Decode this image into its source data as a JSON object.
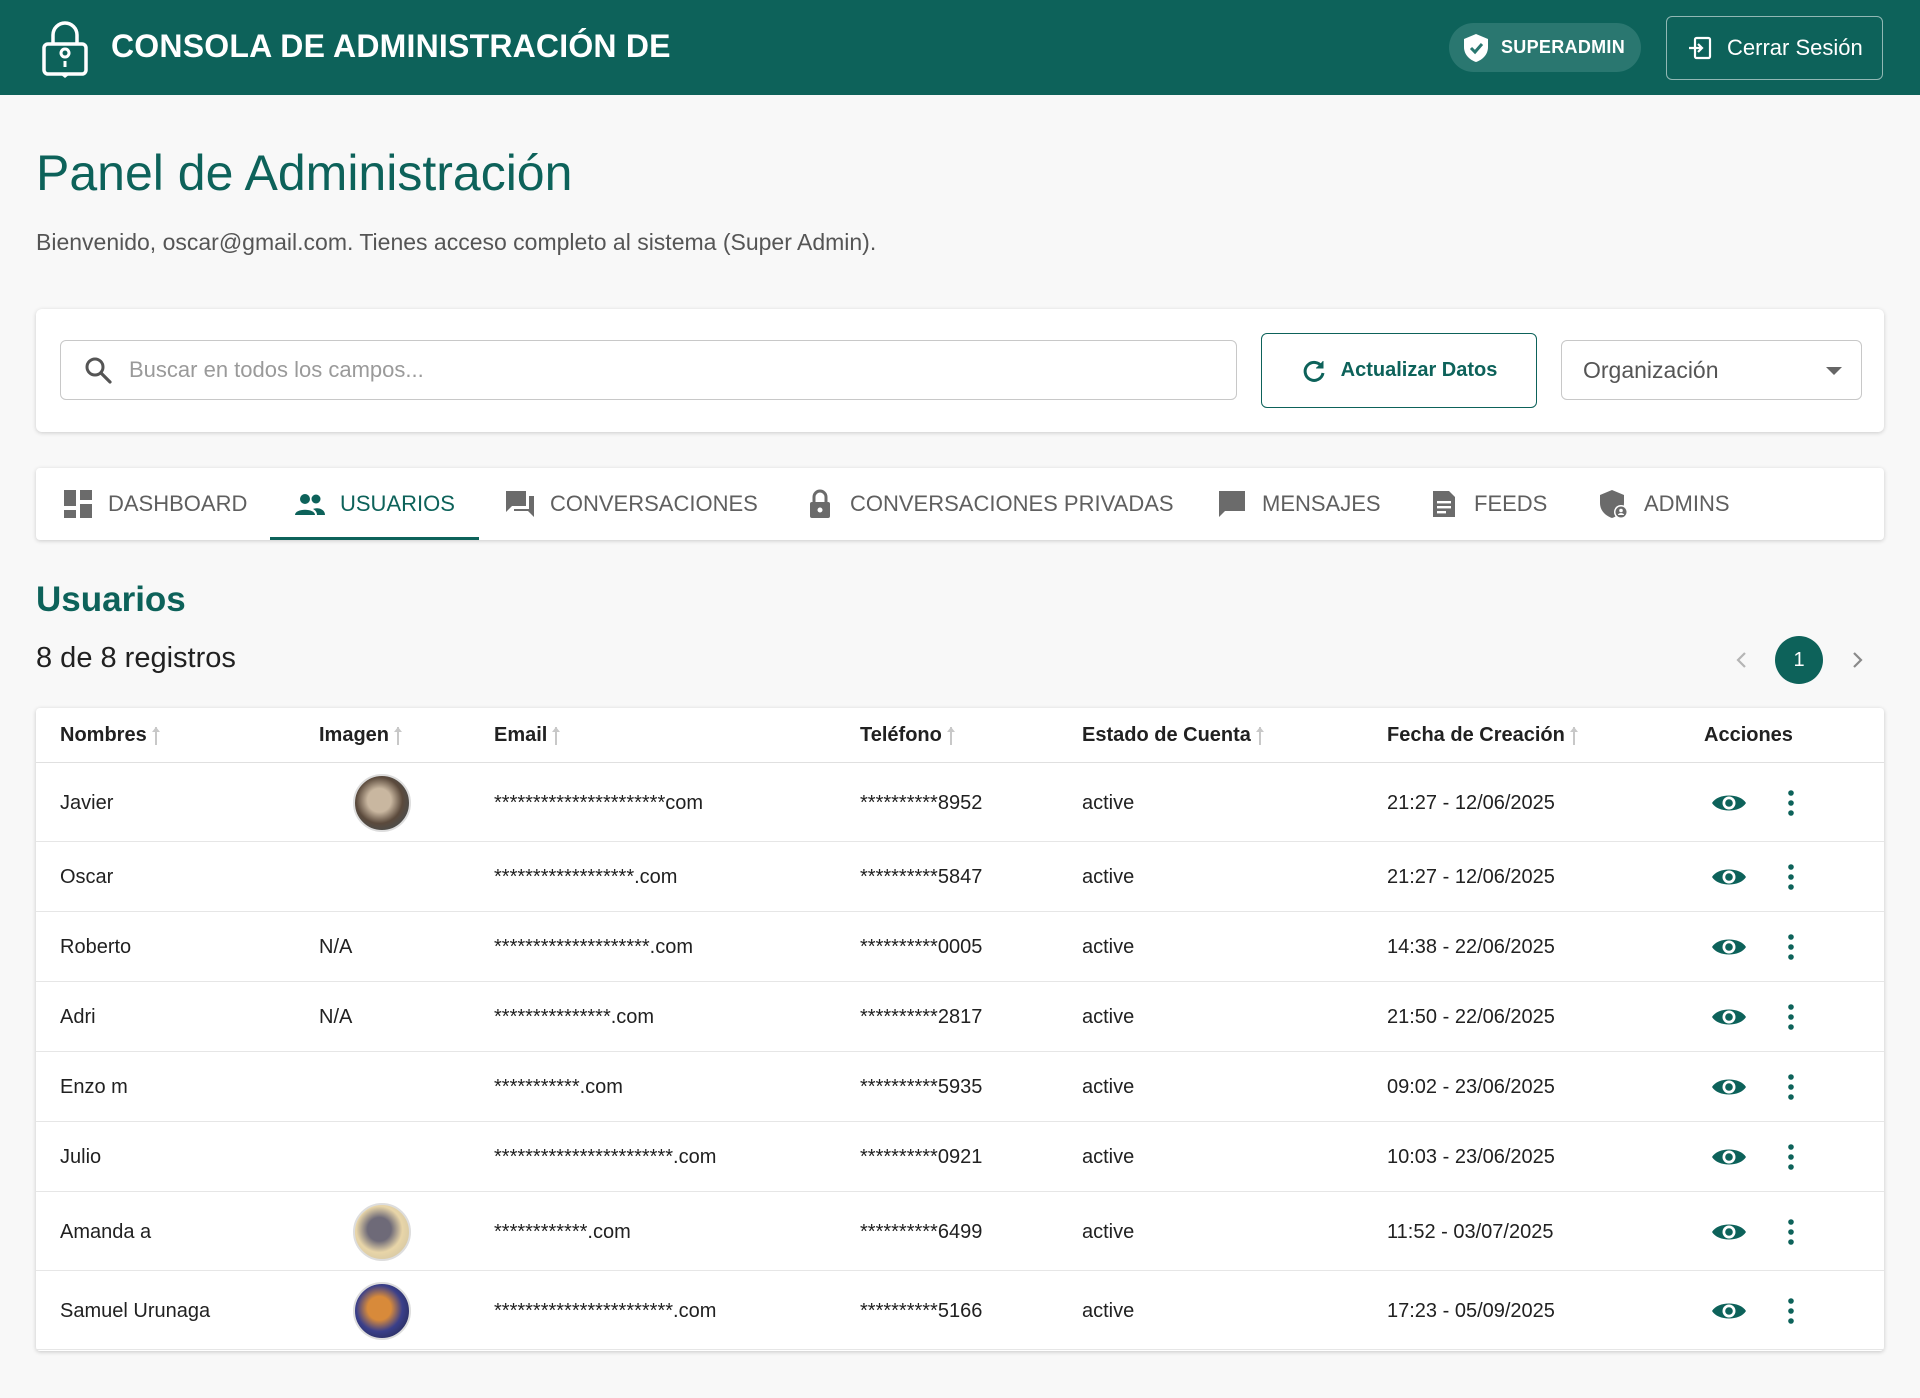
{
  "header": {
    "title": "CONSOLA DE ADMINISTRACIÓN DE",
    "role_badge": "SUPERADMIN",
    "logout_label": "Cerrar Sesión",
    "brand_color": "#0d625a"
  },
  "main": {
    "page_title": "Panel de Administración",
    "welcome": "Bienvenido, oscar@gmail.com. Tienes acceso completo al sistema (Super Admin)."
  },
  "filters": {
    "search_placeholder": "Buscar en todos los campos...",
    "refresh_label": "Actualizar Datos",
    "organization_select": "Organización"
  },
  "tabs": [
    {
      "label": "DASHBOARD",
      "icon": "dashboard-icon",
      "active": false
    },
    {
      "label": "USUARIOS",
      "icon": "people-icon",
      "active": true
    },
    {
      "label": "CONVERSACIONES",
      "icon": "forum-icon",
      "active": false
    },
    {
      "label": "CONVERSACIONES PRIVADAS",
      "icon": "lock-icon",
      "active": false
    },
    {
      "label": "MENSAJES",
      "icon": "chat-icon",
      "active": false
    },
    {
      "label": "FEEDS",
      "icon": "article-icon",
      "active": false
    },
    {
      "label": "ADMINS",
      "icon": "admin-shield-icon",
      "active": false
    }
  ],
  "section": {
    "title": "Usuarios",
    "record_count": "8 de 8 registros",
    "current_page": "1"
  },
  "table": {
    "columns": [
      "Nombres",
      "Imagen",
      "Email",
      "Teléfono",
      "Estado de Cuenta",
      "Fecha de Creación",
      "Acciones"
    ],
    "rows": [
      {
        "name": "Javier",
        "image": "",
        "has_avatar": true,
        "email": "**********************com",
        "phone": "**********8952",
        "status": "active",
        "created": "21:27 - 12/06/2025"
      },
      {
        "name": "Oscar",
        "image": "",
        "has_avatar": false,
        "email": "******************.com",
        "phone": "**********5847",
        "status": "active",
        "created": "21:27 - 12/06/2025"
      },
      {
        "name": "Roberto",
        "image": "N/A",
        "has_avatar": false,
        "email": "********************.com",
        "phone": "**********0005",
        "status": "active",
        "created": "14:38 - 22/06/2025"
      },
      {
        "name": "Adri",
        "image": "N/A",
        "has_avatar": false,
        "email": "***************.com",
        "phone": "**********2817",
        "status": "active",
        "created": "21:50 - 22/06/2025"
      },
      {
        "name": "Enzo m",
        "image": "",
        "has_avatar": false,
        "email": "***********.com",
        "phone": "**********5935",
        "status": "active",
        "created": "09:02 - 23/06/2025"
      },
      {
        "name": "Julio",
        "image": "",
        "has_avatar": false,
        "email": "***********************.com",
        "phone": "**********0921",
        "status": "active",
        "created": "10:03 - 23/06/2025"
      },
      {
        "name": "Amanda a",
        "image": "",
        "has_avatar": true,
        "email": "************.com",
        "phone": "**********6499",
        "status": "active",
        "created": "11:52 - 03/07/2025"
      },
      {
        "name": "Samuel Urunaga",
        "image": "",
        "has_avatar": true,
        "email": "***********************.com",
        "phone": "**********5166",
        "status": "active",
        "created": "17:23 - 05/09/2025"
      }
    ]
  }
}
